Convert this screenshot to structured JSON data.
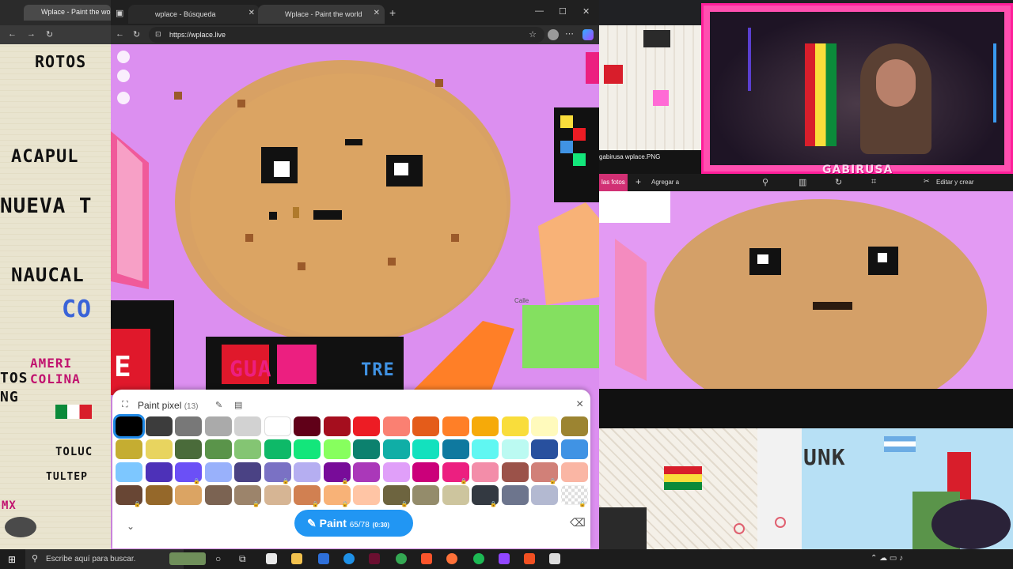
{
  "left_window": {
    "tab_title": "Wplace - Paint the world",
    "canvas_texts": [
      "ROTOS",
      "ACAPUL",
      "NUEVA T",
      "NAUCAL",
      "CO",
      "AMERI",
      "COLINA",
      "TOS",
      "NG",
      "TOLUC",
      "TULTEP",
      "MX"
    ]
  },
  "browser": {
    "tabs": [
      {
        "title": "wplace - Búsqueda",
        "active": false
      },
      {
        "title": "Wplace - Paint the world",
        "active": true
      }
    ],
    "new_tab": "+",
    "url": "https://wplace.live",
    "window_controls": {
      "minimize": "—",
      "maximize": "☐",
      "close": "✕"
    }
  },
  "canvas": {
    "map_label": "Calle",
    "bottom_texts": [
      "E",
      "GUA",
      "TRE"
    ]
  },
  "panel": {
    "title": "Paint pixel",
    "count": "(13)",
    "close": "×",
    "paint_label": "Paint",
    "paint_charges": "65/78",
    "paint_timer": "(0:30)",
    "selected_color": "#000000",
    "colors": [
      [
        "#000000",
        "#3c3c3c",
        "#787878",
        "#aaaaaa",
        "#d2d2d2",
        "#ffffff",
        "#600018",
        "#a50e1e",
        "#ed1c24",
        "#fa8072",
        "#e45c1a",
        "#ff7f27",
        "#f6aa09",
        "#f9dd3b",
        "#fffabc",
        "#9c8431"
      ],
      [
        "#c5ad31",
        "#e8d45f",
        "#4a6b3a",
        "#5a944a",
        "#84c573",
        "#0eb968",
        "#13e67b",
        "#87ff5e",
        "#0c816e",
        "#10aea6",
        "#13e1be",
        "#0f799f",
        "#60f7f2",
        "#bbfaf2",
        "#28509e",
        "#4093e4"
      ],
      [
        "#7dc7ff",
        "#4d31b8",
        "#6b50f6",
        "#99b1fb",
        "#4a4284",
        "#7a71c4",
        "#b5aef1",
        "#780c99",
        "#aa38b9",
        "#e09ff9",
        "#cb007a",
        "#ec1f80",
        "#f38da9",
        "#9b5249",
        "#d18078",
        "#fab6a4"
      ],
      [
        "#684634",
        "#95682a",
        "#dba463",
        "#7b6352",
        "#9c846b",
        "#d6b594",
        "#d18051",
        "#f8b277",
        "#ffc5a5",
        "#6d643f",
        "#948c6b",
        "#cdc59e",
        "#333941",
        "#6d758d",
        "#b3b9d1",
        "transparent"
      ]
    ],
    "locked_indices": [
      [
        4,
        9
      ],
      [
        4,
        8
      ],
      [
        3,
        7
      ],
      [
        2,
        2
      ],
      [
        2,
        5
      ],
      [
        2,
        7
      ],
      [
        2,
        11
      ],
      [
        2,
        14
      ],
      [
        3,
        0
      ],
      [
        3,
        4
      ],
      [
        3,
        6
      ],
      [
        3,
        9
      ],
      [
        3,
        12
      ],
      [
        3,
        15
      ]
    ]
  },
  "stream": {
    "cam_label": "GABIRUSA",
    "viewer_filename": "gabirusa wplace.PNG",
    "viewer_actions": [
      "las fotos",
      "Agregar a"
    ],
    "viewer_edit": "Editar y crear"
  },
  "taskbar": {
    "search_placeholder": "Escribe aquí para buscar."
  }
}
